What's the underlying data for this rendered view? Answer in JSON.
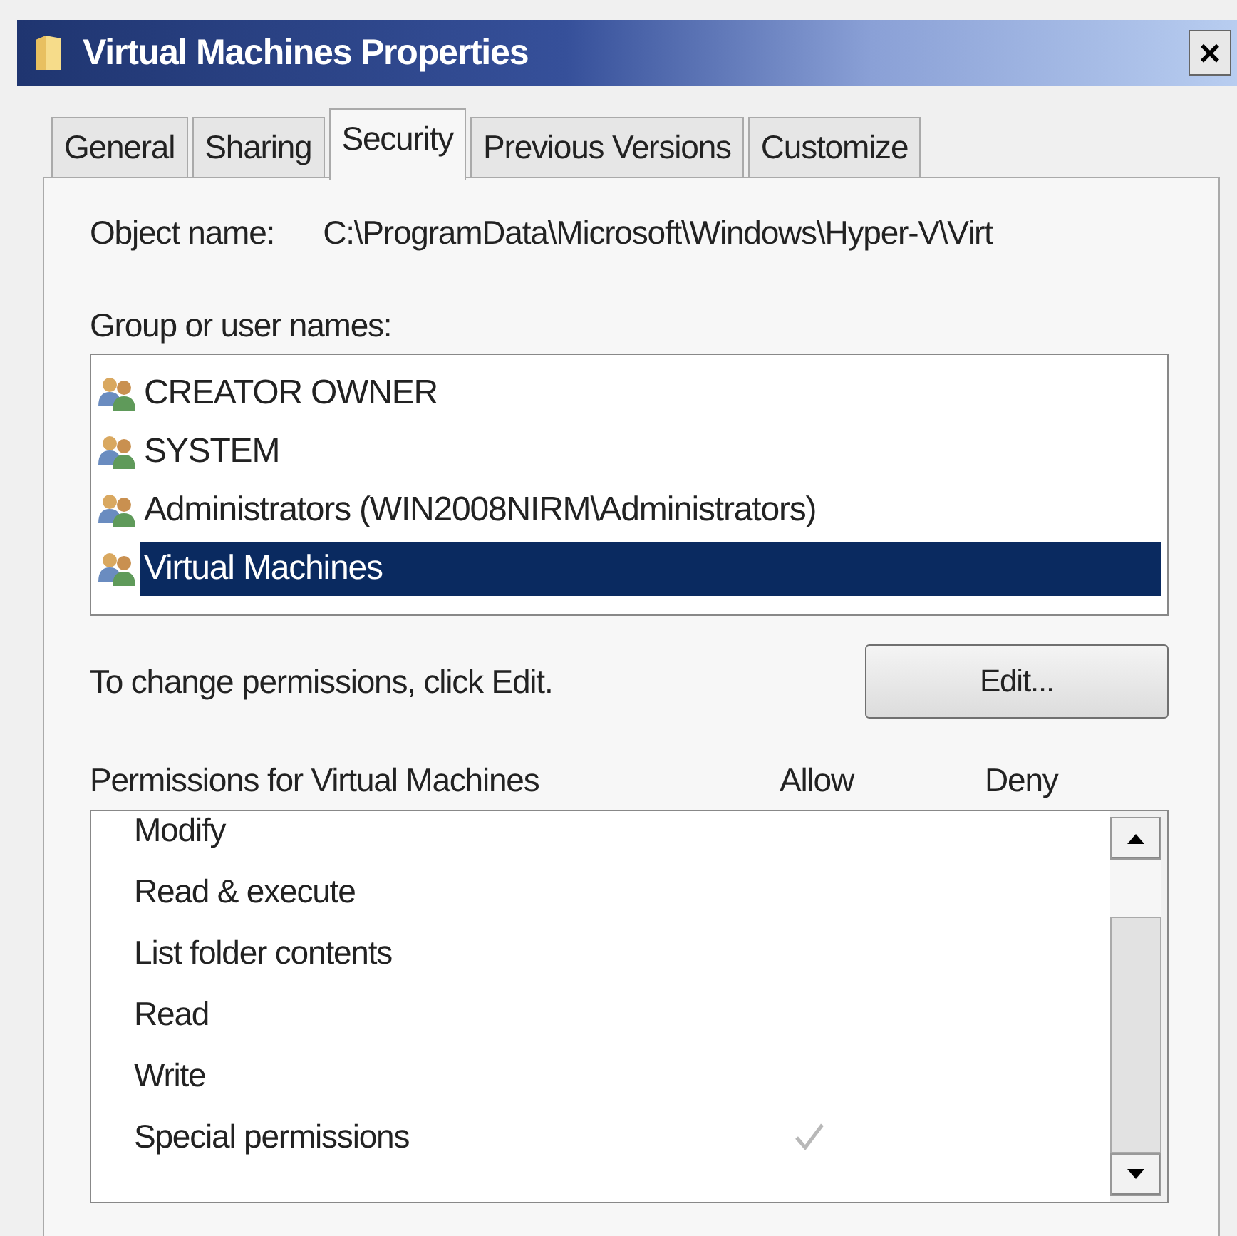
{
  "window": {
    "title": "Virtual Machines Properties",
    "close": "×"
  },
  "tabs": [
    {
      "label": "General",
      "selected": false
    },
    {
      "label": "Sharing",
      "selected": false
    },
    {
      "label": "Security",
      "selected": true
    },
    {
      "label": "Previous Versions",
      "selected": false
    },
    {
      "label": "Customize",
      "selected": false
    }
  ],
  "object_name": {
    "label": "Object name:",
    "value": "C:\\ProgramData\\Microsoft\\Windows\\Hyper-V\\Virt"
  },
  "group_list": {
    "label": "Group or user names:",
    "items": [
      {
        "name": "CREATOR OWNER",
        "selected": false
      },
      {
        "name": "SYSTEM",
        "selected": false
      },
      {
        "name": "Administrators (WIN2008NIRM\\Administrators)",
        "selected": false
      },
      {
        "name": "Virtual Machines",
        "selected": true
      }
    ]
  },
  "change_hint": "To change permissions, click Edit.",
  "edit_button": "Edit...",
  "permissions": {
    "label": "Permissions for Virtual Machines",
    "allow_header": "Allow",
    "deny_header": "Deny",
    "rows": [
      {
        "name": "Modify",
        "allow": false,
        "deny": false
      },
      {
        "name": "Read & execute",
        "allow": false,
        "deny": false
      },
      {
        "name": "List folder contents",
        "allow": false,
        "deny": false
      },
      {
        "name": "Read",
        "allow": false,
        "deny": false
      },
      {
        "name": "Write",
        "allow": false,
        "deny": false
      },
      {
        "name": "Special permissions",
        "allow": true,
        "deny": false
      }
    ]
  }
}
